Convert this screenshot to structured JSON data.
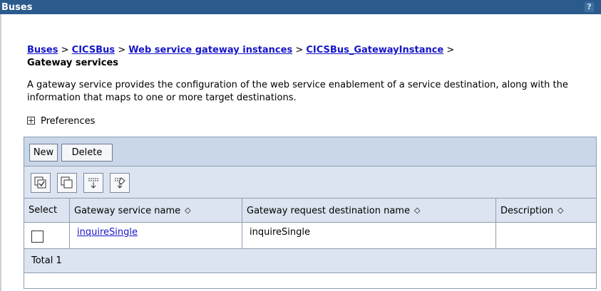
{
  "window": {
    "title": "Buses",
    "help": "?"
  },
  "breadcrumb": {
    "items": [
      "Buses",
      "CICSBus",
      "Web service gateway instances",
      "CICSBus_GatewayInstance"
    ],
    "separator": ">",
    "current": "Gateway services"
  },
  "description": "A gateway service provides the configuration of the web service enablement of a service destination, along with the information that maps to one or more target destinations.",
  "preferences": {
    "label": "Preferences"
  },
  "buttons": {
    "new": "New",
    "delete": "Delete"
  },
  "icons": [
    "select-all-icon",
    "deselect-all-icon",
    "show-filter-icon",
    "clear-filter-icon"
  ],
  "table": {
    "columns": [
      "Select",
      "Gateway service name",
      "Gateway request destination name",
      "Description"
    ],
    "sort_glyph": "◇",
    "rows": [
      {
        "name": "inquireSingle",
        "destination": "inquireSingle",
        "description": ""
      }
    ],
    "total": "Total 1"
  },
  "colors": {
    "titlebar": "#2b5a8c",
    "link": "#1616c8",
    "panel": "#dbe4f0",
    "button_bar": "#c9d7e8"
  }
}
